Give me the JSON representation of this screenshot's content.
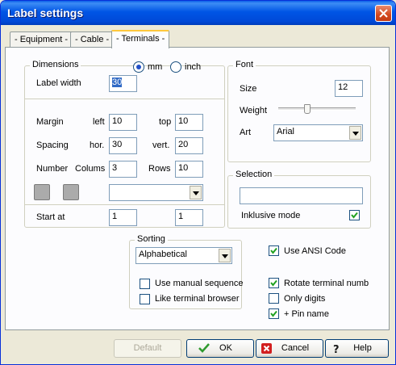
{
  "window": {
    "title": "Label settings"
  },
  "tabs": [
    "- Equipment -",
    "- Cable -",
    "- Terminals -"
  ],
  "dimensions": {
    "title": "Dimensions",
    "unit_mm": "mm",
    "unit_inch": "inch",
    "unit_selected": "mm",
    "label_width_label": "Label width",
    "label_width": "30",
    "margin_label": "Margin",
    "left_label": "left",
    "margin_left": "10",
    "top_label": "top",
    "margin_top": "10",
    "spacing_label": "Spacing",
    "hor_label": "hor.",
    "spacing_hor": "30",
    "vert_label": "vert.",
    "spacing_vert": "20",
    "number_label": "Number",
    "columns_label": "Colums",
    "columns": "3",
    "rows_label": "Rows",
    "rows": "10",
    "preset_value": "",
    "start_at_label": "Start at",
    "start_at_1": "1",
    "start_at_2": "1"
  },
  "font": {
    "title": "Font",
    "size_label": "Size",
    "size": "12",
    "weight_label": "Weight",
    "weight_level": 0.38,
    "art_label": "Art",
    "art": "Arial"
  },
  "selection": {
    "title": "Selection",
    "value": "",
    "inclusive_label": "Inklusive mode",
    "inclusive_checked": true
  },
  "sorting": {
    "title": "Sorting",
    "value": "Alphabetical",
    "manual_label": "Use manual sequence",
    "manual_checked": false,
    "browser_label": "Like terminal browser",
    "browser_checked": false
  },
  "options": {
    "ansi_label": "Use ANSI Code",
    "ansi_checked": true,
    "rotate_label": "Rotate terminal numb",
    "rotate_checked": true,
    "only_digits_label": "Only digits",
    "only_digits_checked": false,
    "pin_name_label": "+ Pin name",
    "pin_name_checked": true
  },
  "buttons": {
    "default": "Default",
    "ok": "OK",
    "cancel": "Cancel",
    "help": "Help"
  }
}
